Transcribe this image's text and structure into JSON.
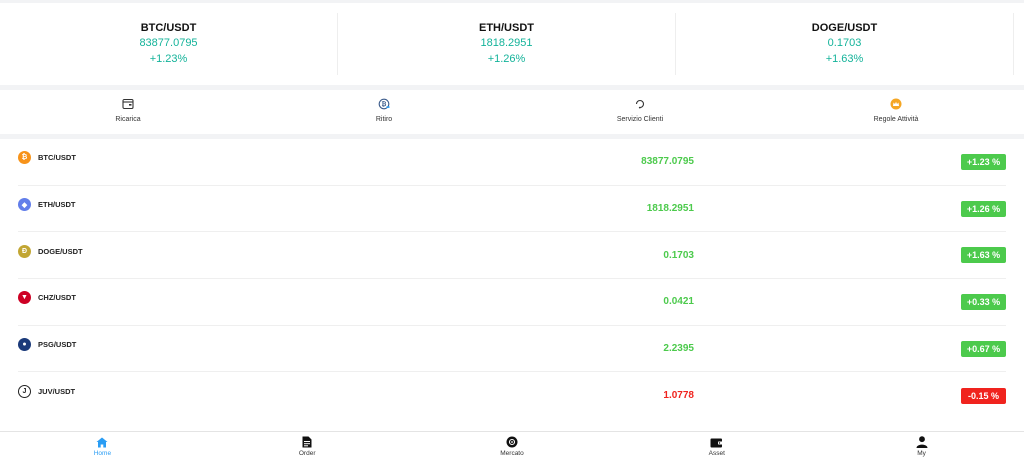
{
  "tickers": [
    {
      "symbol": "BTC/USDT",
      "price": "83877.0795",
      "change": "+1.23%"
    },
    {
      "symbol": "ETH/USDT",
      "price": "1818.2951",
      "change": "+1.26%"
    },
    {
      "symbol": "DOGE/USDT",
      "price": "0.1703",
      "change": "+1.63%"
    }
  ],
  "quick_actions": [
    {
      "label": "Ricarica",
      "icon": "wallet-card-icon"
    },
    {
      "label": "Ritiro",
      "icon": "bitcoin-withdraw-icon"
    },
    {
      "label": "Servizio Clienti",
      "icon": "customer-service-icon"
    },
    {
      "label": "Regole Attività",
      "icon": "crown-icon"
    }
  ],
  "markets": [
    {
      "symbol": "BTC/USDT",
      "price": "83877.0795",
      "change": "+1.23 %",
      "direction": "up",
      "icon": "btc-icon",
      "icon_color": "#f7931a"
    },
    {
      "symbol": "ETH/USDT",
      "price": "1818.2951",
      "change": "+1.26 %",
      "direction": "up",
      "icon": "eth-icon",
      "icon_color": "#627eea"
    },
    {
      "symbol": "DOGE/USDT",
      "price": "0.1703",
      "change": "+1.63 %",
      "direction": "up",
      "icon": "doge-icon",
      "icon_color": "#c2a633"
    },
    {
      "symbol": "CHZ/USDT",
      "price": "0.0421",
      "change": "+0.33 %",
      "direction": "up",
      "icon": "chz-icon",
      "icon_color": "#cd0124"
    },
    {
      "symbol": "PSG/USDT",
      "price": "2.2395",
      "change": "+0.67 %",
      "direction": "up",
      "icon": "psg-icon",
      "icon_color": "#1b3a7a"
    },
    {
      "symbol": "JUV/USDT",
      "price": "1.0778",
      "change": "-0.15 %",
      "direction": "down",
      "icon": "juv-icon",
      "icon_color": "#222222"
    }
  ],
  "tabs": [
    {
      "label": "Home",
      "icon": "home-icon",
      "active": true
    },
    {
      "label": "Order",
      "icon": "order-document-icon",
      "active": false
    },
    {
      "label": "Mercato",
      "icon": "market-icon",
      "active": false
    },
    {
      "label": "Asset",
      "icon": "wallet-icon",
      "active": false
    },
    {
      "label": "My",
      "icon": "user-icon",
      "active": false
    }
  ],
  "colors": {
    "up": "#4cca4c",
    "down": "#f0231e",
    "ticker_green": "#14b39a",
    "tab_active": "#2a9df4"
  }
}
